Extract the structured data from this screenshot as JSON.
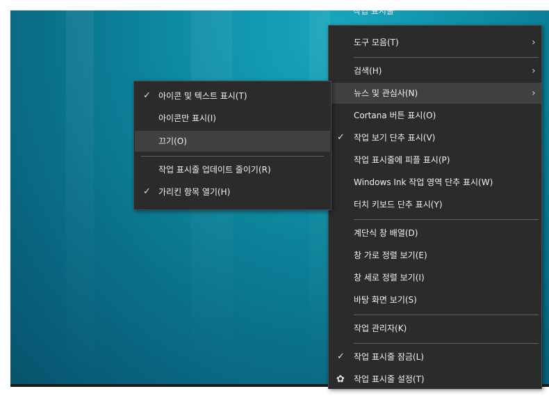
{
  "header_partial": "작업 표시줄",
  "main_menu": {
    "items": [
      {
        "label": "도구 모음(T)",
        "submenu": true
      },
      {
        "label": "검색(H)",
        "submenu": true
      },
      {
        "label": "뉴스 및 관심사(N)",
        "submenu": true,
        "highlighted": true
      },
      {
        "label": "Cortana 버튼 표시(O)"
      },
      {
        "label": "작업 보기 단추 표시(V)",
        "checked": true
      },
      {
        "label": "작업 표시줄에 피플 표시(P)"
      },
      {
        "label": "Windows Ink 작업 영역 단추 표시(W)"
      },
      {
        "label": "터치 키보드 단추 표시(Y)"
      },
      {
        "label": "계단식 창 배열(D)"
      },
      {
        "label": "창 가로 정렬 보기(E)"
      },
      {
        "label": "창 세로 정렬 보기(I)"
      },
      {
        "label": "바탕 화면 보기(S)"
      },
      {
        "label": "작업 관리자(K)"
      },
      {
        "label": "작업 표시줄 잠금(L)",
        "checked": true
      },
      {
        "label": "작업 표시줄 설정(T)",
        "icon": "gear-icon"
      }
    ]
  },
  "sub_menu": {
    "items": [
      {
        "label": "아이콘 및 텍스트 표시(T)",
        "checked": true
      },
      {
        "label": "아이콘만 표시(I)"
      },
      {
        "label": "끄기(O)",
        "highlighted": true
      },
      {
        "label": "작업 표시줄 업데이트 줄이기(R)"
      },
      {
        "label": "가리킨 항목 열기(H)",
        "checked": true
      }
    ]
  },
  "glyphs": {
    "check": "✓",
    "chevron": "›",
    "gear": "✿"
  },
  "colors": {
    "menu_bg": "#2b2b2b",
    "highlight": "#404040",
    "desktop": "#0e8fa6"
  }
}
